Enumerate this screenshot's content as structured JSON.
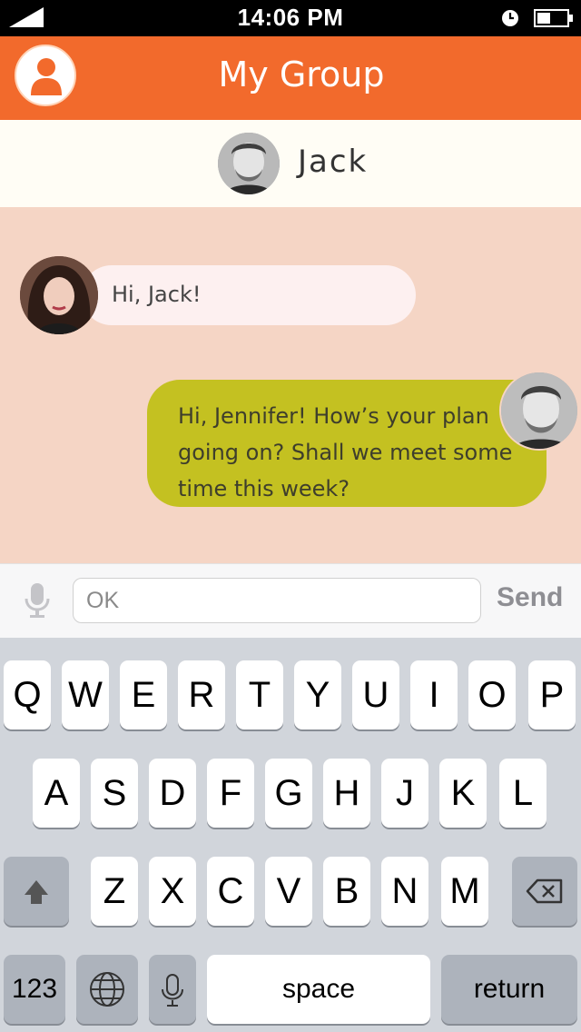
{
  "status_bar": {
    "time": "14:06 PM"
  },
  "header": {
    "title": "My Group"
  },
  "contact": {
    "name": "Jack"
  },
  "messages": [
    {
      "from": "Jennifer",
      "text": "Hi, Jack!"
    },
    {
      "from": "Jack",
      "text": "Hi, Jennifer! How’s your plan going on? Shall we meet some time this week?"
    }
  ],
  "input": {
    "value": "OK",
    "send_label": "Send"
  },
  "keyboard": {
    "row1": [
      "Q",
      "W",
      "E",
      "R",
      "T",
      "Y",
      "U",
      "I",
      "O",
      "P"
    ],
    "row2": [
      "A",
      "S",
      "D",
      "F",
      "G",
      "H",
      "J",
      "K",
      "L"
    ],
    "row3": [
      "Z",
      "X",
      "C",
      "V",
      "B",
      "N",
      "M"
    ],
    "numbers_label": "123",
    "space_label": "space",
    "return_label": "return"
  },
  "colors": {
    "header": "#f26a2c",
    "chat_background": "#f5d5c5",
    "incoming_bubble": "#fdf0f0",
    "outgoing_bubble": "#c4c121"
  },
  "icons": [
    "signal-icon",
    "clock-icon",
    "battery-icon",
    "user-icon",
    "microphone-icon",
    "shift-icon",
    "delete-icon",
    "globe-icon",
    "dictation-icon"
  ]
}
